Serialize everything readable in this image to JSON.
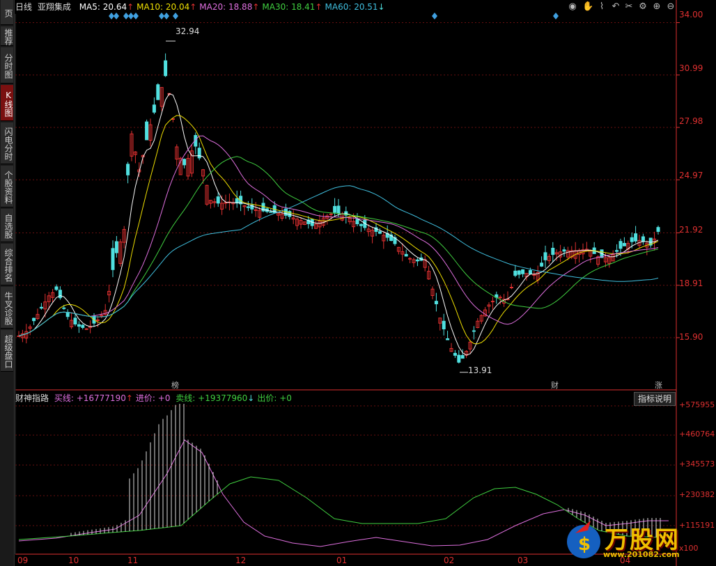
{
  "sidebar": {
    "items": [
      {
        "label": "页",
        "name": "sidebar-item-page"
      },
      {
        "label": "推荐",
        "name": "sidebar-item-recommend"
      },
      {
        "label": "分时图",
        "name": "sidebar-item-intraday"
      },
      {
        "label": "K线图",
        "name": "sidebar-item-kline"
      },
      {
        "label": "闪电分时",
        "name": "sidebar-item-flash-intraday"
      },
      {
        "label": "个股资料",
        "name": "sidebar-item-stock-info"
      },
      {
        "label": "自选股",
        "name": "sidebar-item-watchlist"
      },
      {
        "label": "综合排名",
        "name": "sidebar-item-ranking"
      },
      {
        "label": "牛叉诊股",
        "name": "sidebar-item-diagnosis"
      },
      {
        "label": "超级盘口",
        "name": "sidebar-item-super-quote"
      }
    ]
  },
  "header": {
    "period": "日线",
    "stock_name": "亚翔集成",
    "ma5": "MA5: 20.64",
    "ma10": "MA10: 20.04",
    "ma20": "MA20: 18.88",
    "ma30": "MA30: 18.41",
    "ma60": "MA60: 20.51",
    "ma10_arrow": "↑",
    "ma20_arrow": "↑",
    "ma30_arrow": "↑",
    "ma60_arrow": "↓",
    "ma5_arrow": "↑"
  },
  "colors": {
    "ma5": "#ffffff",
    "ma10": "#f0e000",
    "ma20": "#e070e0",
    "ma30": "#40d040",
    "ma60": "#40c0e0",
    "up": "#e03030",
    "down": "#50e0e0",
    "axis": "#e03030",
    "buy_line": "#e070e0",
    "sell_line": "#40d040"
  },
  "price_axis": [
    "34.00",
    "30.99",
    "27.98",
    "24.97",
    "21.92",
    "18.91",
    "15.90"
  ],
  "annotations": {
    "high": "32.94",
    "low": "13.91",
    "events": [
      "榜",
      "财",
      "涨"
    ]
  },
  "indicator": {
    "name": "财神指路",
    "buy_line": "买线: +16777190",
    "buy_arrow": "↑",
    "enter_price": "进价: +0",
    "sell_line": "卖线: +19377960",
    "sell_arrow": "↓",
    "exit_price": "出价: +0",
    "explain_button": "指标说明",
    "axis": [
      "+575955",
      "+460764",
      "+345573",
      "+230382",
      "+115191",
      "x100"
    ]
  },
  "months": [
    "09",
    "10",
    "11",
    "12",
    "01",
    "02",
    "03",
    "04"
  ],
  "logo": {
    "text": "万股网",
    "url": "www.201082.com"
  },
  "chart_data": {
    "type": "candlestick",
    "ylim": [
      13.5,
      34.5
    ],
    "price_ticks": [
      34.0,
      30.99,
      27.98,
      24.97,
      21.92,
      18.91,
      15.9
    ],
    "high_marker": 32.94,
    "low_marker": 13.91
  }
}
